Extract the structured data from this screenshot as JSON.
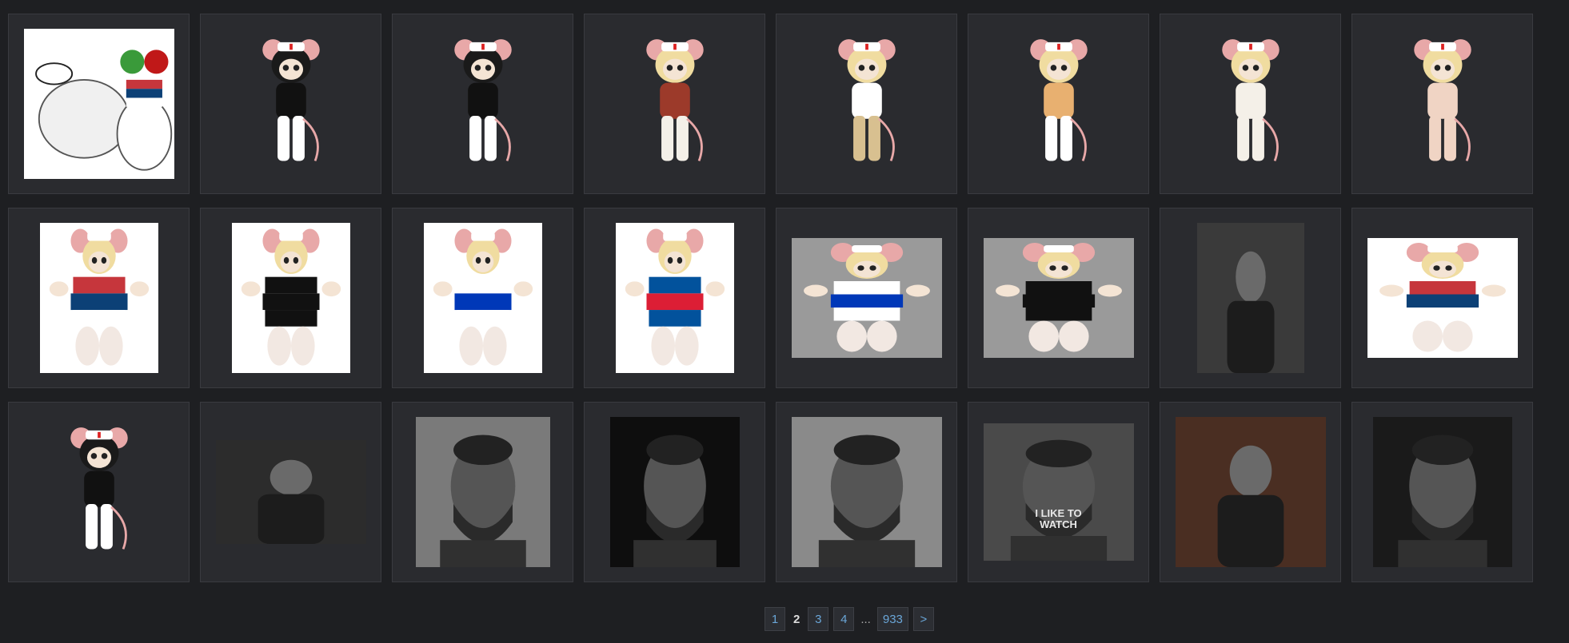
{
  "gallery": {
    "items": [
      {
        "kind": "rat-doodle",
        "desc": "sketch",
        "bg": "#ffffff",
        "w": 188,
        "h": 188
      },
      {
        "kind": "rat",
        "bg": "#2a2b2f",
        "hair": "#1a1a1a",
        "top": "#111111",
        "bottom": "#ffffff",
        "w": 188,
        "h": 188
      },
      {
        "kind": "rat",
        "bg": "#2a2b2f",
        "hair": "#1a1a1a",
        "top": "#111111",
        "bottom": "#ffffff",
        "w": 188,
        "h": 188
      },
      {
        "kind": "rat",
        "bg": "#2a2b2f",
        "hair": "#f0dca0",
        "top": "#9c3a2a",
        "bottom": "#f4f0e8",
        "w": 188,
        "h": 188
      },
      {
        "kind": "rat",
        "bg": "#2a2b2f",
        "hair": "#f0dca0",
        "top": "#ffffff",
        "bottom": "#d8c090",
        "w": 188,
        "h": 188
      },
      {
        "kind": "rat",
        "bg": "#2a2b2f",
        "hair": "#f0dca0",
        "top": "#e8b070",
        "bottom": "#ffffff",
        "w": 188,
        "h": 188
      },
      {
        "kind": "rat",
        "bg": "#2a2b2f",
        "hair": "#f0dca0",
        "top": "#f4f0e8",
        "bottom": "#f4f0e8",
        "w": 188,
        "h": 188
      },
      {
        "kind": "rat",
        "bg": "#2a2b2f",
        "hair": "#f0dca0",
        "top": "#f0d4c4",
        "bottom": "#f0d4c4",
        "w": 188,
        "h": 188
      },
      {
        "kind": "rat-flag",
        "bg": "#ffffff",
        "flag": [
          "#c6363c",
          "#0c4076",
          "#ffffff"
        ],
        "w": 148,
        "h": 188
      },
      {
        "kind": "rat-flag",
        "bg": "#ffffff",
        "flag": [
          "#111111",
          "#111111",
          "#111111"
        ],
        "w": 148,
        "h": 188
      },
      {
        "kind": "rat-flag",
        "bg": "#ffffff",
        "flag": [
          "#ffffff",
          "#0038b8",
          "#ffffff"
        ],
        "w": 148,
        "h": 188
      },
      {
        "kind": "rat-flag",
        "bg": "#ffffff",
        "flag": [
          "#02529c",
          "#dc1e35",
          "#02529c"
        ],
        "w": 148,
        "h": 188
      },
      {
        "kind": "rat-flag",
        "bg": "#9a9a9a",
        "flag": [
          "#ffffff",
          "#0038b8",
          "#ffffff"
        ],
        "w": 188,
        "h": 150
      },
      {
        "kind": "rat-flag",
        "bg": "#9a9a9a",
        "flag": [
          "#111111",
          "#111111",
          "#111111"
        ],
        "w": 188,
        "h": 150
      },
      {
        "kind": "photo",
        "bg": "#3a3a3a",
        "w": 134,
        "h": 188
      },
      {
        "kind": "rat-flag",
        "bg": "#ffffff",
        "flag": [
          "#c6363c",
          "#0c4076",
          "#ffffff"
        ],
        "w": 188,
        "h": 150
      },
      {
        "kind": "rat",
        "bg": "#2a2b2f",
        "hair": "#1a1a1a",
        "top": "#111111",
        "bottom": "#ffffff",
        "w": 188,
        "h": 188
      },
      {
        "kind": "photo",
        "bg": "#2c2c2c",
        "w": 188,
        "h": 130
      },
      {
        "kind": "face",
        "bg": "#7a7a7a",
        "w": 168,
        "h": 188
      },
      {
        "kind": "face",
        "bg": "#0e0e0e",
        "w": 162,
        "h": 188
      },
      {
        "kind": "face",
        "bg": "#8a8a8a",
        "w": 188,
        "h": 188
      },
      {
        "kind": "face",
        "bg": "#4a4a4a",
        "caption": "I LIKE TO\nWATCH",
        "w": 188,
        "h": 172
      },
      {
        "kind": "photo",
        "bg": "#4a2e22",
        "w": 188,
        "h": 188
      },
      {
        "kind": "face",
        "bg": "#1a1a1a",
        "w": 174,
        "h": 188
      }
    ]
  },
  "pagination": {
    "pages": [
      {
        "label": "1",
        "current": false
      },
      {
        "label": "2",
        "current": true
      },
      {
        "label": "3",
        "current": false
      },
      {
        "label": "4",
        "current": false
      }
    ],
    "ellipsis": "...",
    "last_page": "933",
    "next_label": ">"
  }
}
